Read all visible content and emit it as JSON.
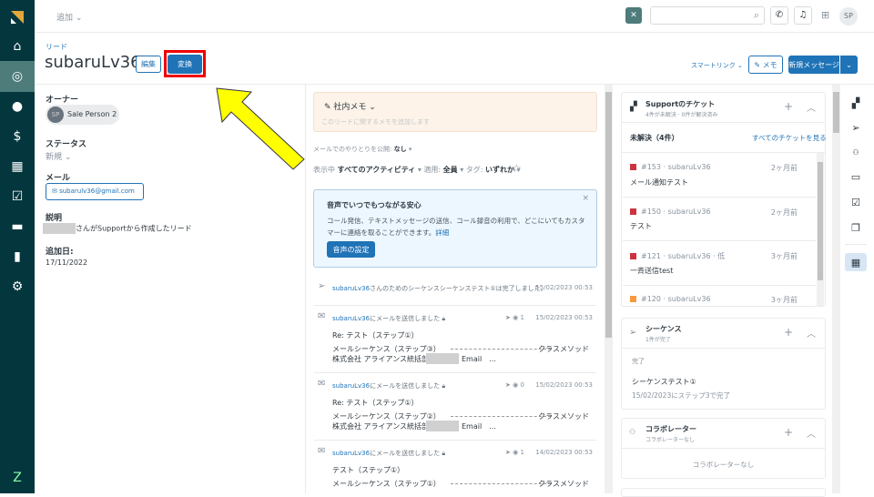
{
  "topbar": {
    "add_label": "追加",
    "avatar": "SP"
  },
  "header": {
    "breadcrumb": "リード",
    "title": "subaruLv36",
    "edit": "編集",
    "convert": "変換",
    "smartlink": "スマートリンク",
    "memo": "メモ",
    "new_message": "新規メッセージ"
  },
  "details": {
    "owner_label": "オーナー",
    "owner_initials": "SP",
    "owner_name": "Sale Person 2",
    "status_label": "ステータス",
    "status_value": "新規",
    "email_label": "メール",
    "email_value": "subarulv36@gmail.com",
    "desc_label": "説明",
    "desc_value": "さんがSupportから作成したリード",
    "added_label": "追加日:",
    "added_value": "17/11/2022"
  },
  "memo": {
    "title": "社内メモ",
    "placeholder": "このリードに関するメモを追加します"
  },
  "filters": {
    "public_label": "メールでのやりとりを公開:",
    "public_value": "なし",
    "showing": "表示中",
    "activity": "すべてのアクティビティ",
    "applied": "適用:",
    "applied_value": "全員",
    "tag": "タグ:",
    "tag_value": "いずれか"
  },
  "promo": {
    "title": "音声でいつでもつながる安心",
    "body": "コール発信、テキストメッセージの送信、コール録音の利用で、どこにいてもカスタマーに連絡を取ることができます。",
    "more": "詳細",
    "button": "音声の設定"
  },
  "activities": [
    {
      "link": "subaruLv36",
      "text": "さんのためのシーケンスシーケンステスト①は完了しました。",
      "time": "15/02/2023 00:53"
    },
    {
      "link": "subaruLv36",
      "text": "にメールを送信しました",
      "opens": "1",
      "time": "15/02/2023 00:53",
      "subject": "Re: テスト（ステップ①）",
      "line1": "メールシーケンス（ステップ③）",
      "line1_end": "クラスメソッド",
      "line2": "株式会社 アライアンス統括部",
      "line2_end": "Email　..."
    },
    {
      "link": "subaruLv36",
      "text": "にメールを送信しました",
      "opens": "0",
      "time": "15/02/2023 00:53",
      "subject": "Re: テスト（ステップ①）",
      "line1": "メールシーケンス（ステップ②）",
      "line1_end": "クラスメソッド",
      "line2": "株式会社 アライアンス統括部",
      "line2_end": "Email　..."
    },
    {
      "link": "subaruLv36",
      "text": "にメールを送信しました",
      "opens": "1",
      "time": "14/02/2023 00:53",
      "subject": "テスト（ステップ①）",
      "line1": "メールシーケンス（ステップ①）",
      "line1_end": "クラスメソッド"
    }
  ],
  "support": {
    "title": "Supportのチケット",
    "subtitle": "4件が未解決 · 0件が解決済み",
    "open_label": "未解決（4件）",
    "view_all": "すべてのチケットを見る",
    "tickets": [
      {
        "meta": "#153 · subaruLv36",
        "age": "2ヶ月前",
        "subject": "メール通知テスト",
        "color": "#cc3340"
      },
      {
        "meta": "#150 · subaruLv36",
        "age": "2ヶ月前",
        "subject": "テスト",
        "color": "#cc3340"
      },
      {
        "meta": "#121 · subaruLv36 · 低",
        "age": "3ヶ月前",
        "subject": "一斉送信test",
        "color": "#cc3340"
      },
      {
        "meta": "#120 · subaruLv36",
        "age": "3ヶ月前",
        "subject": "",
        "color": "#f79a3e"
      }
    ]
  },
  "sequence": {
    "title": "シーケンス",
    "subtitle": "1件が完了",
    "status": "完了",
    "name": "シーケンステスト①",
    "detail": "15/02/2023にステップ3で完了"
  },
  "collab": {
    "title": "コラボレーター",
    "subtitle": "コラボレーターなし",
    "empty": "コラボレーターなし"
  }
}
